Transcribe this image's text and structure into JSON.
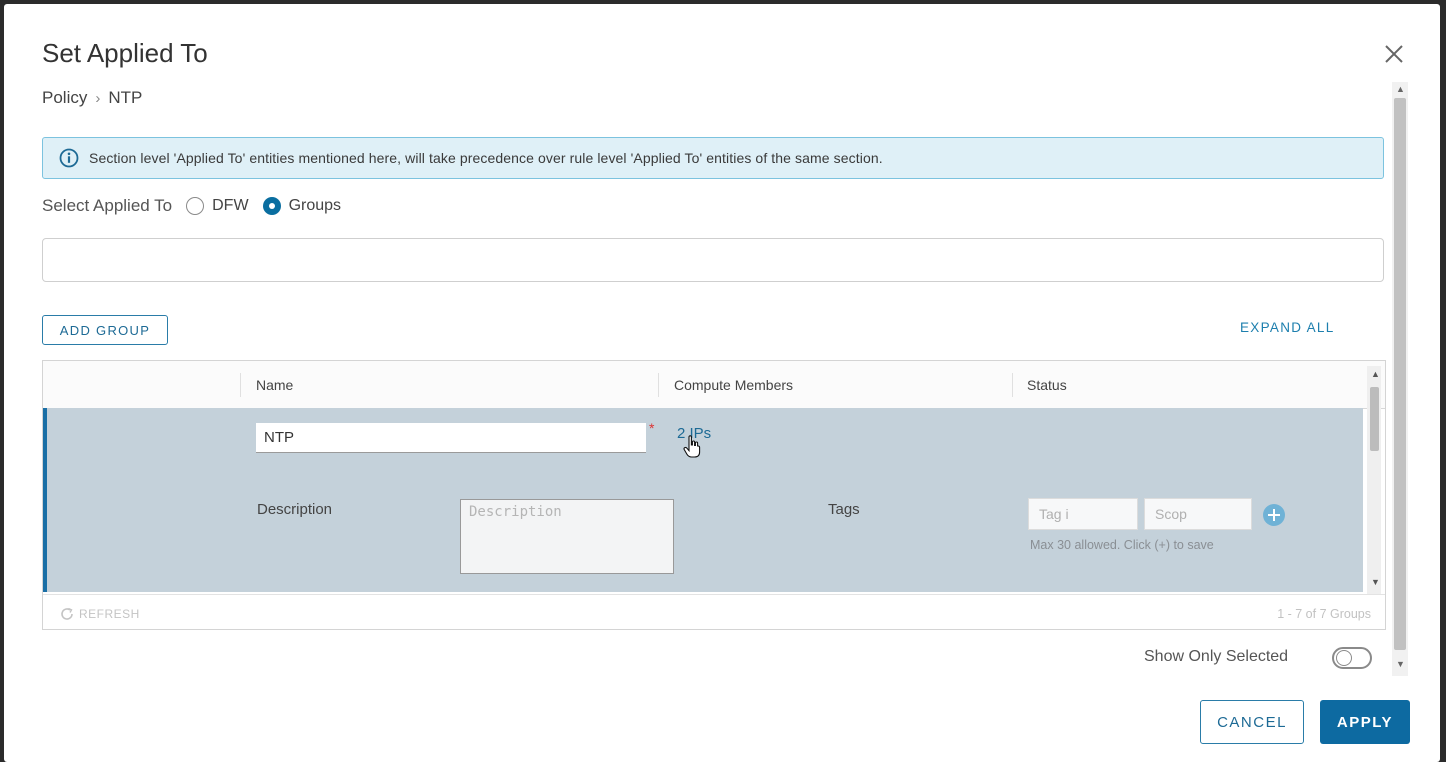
{
  "dialog": {
    "title": "Set Applied To",
    "breadcrumb": [
      "Policy",
      "NTP"
    ],
    "info_text": "Section level 'Applied To' entities mentioned here, will take precedence over rule level 'Applied To' entities of the same section.",
    "select_label": "Select Applied To",
    "radio_options": [
      {
        "label": "DFW",
        "checked": false
      },
      {
        "label": "Groups",
        "checked": true
      }
    ],
    "search_value": "",
    "add_group_label": "ADD GROUP",
    "expand_all_label": "EXPAND ALL"
  },
  "grid": {
    "columns": [
      "Name",
      "Compute Members",
      "Status"
    ],
    "row": {
      "name": "NTP",
      "required_marker": "*",
      "compute_members": "2 IPs",
      "status": "",
      "description_label": "Description",
      "description_placeholder": "Description",
      "tags_label": "Tags",
      "tag_placeholder": "Tag i",
      "scope_placeholder": "Scop",
      "tag_hint": "Max 30 allowed. Click (+) to save"
    },
    "refresh_label": "REFRESH",
    "pager": "1 - 7 of 7 Groups"
  },
  "footer": {
    "show_only_selected_label": "Show Only Selected",
    "show_only_selected_on": false,
    "cancel_label": "CANCEL",
    "apply_label": "APPLY"
  },
  "colors": {
    "accent": "#0d6aa1",
    "info_bg": "#dff0f7",
    "selected_row": "#c4d1da"
  }
}
